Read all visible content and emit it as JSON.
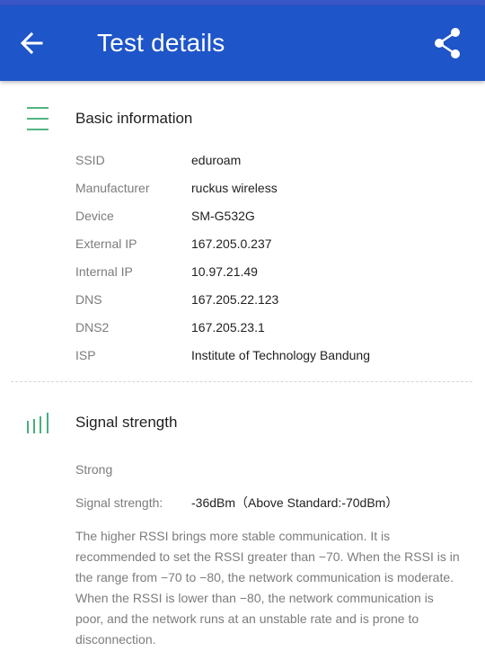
{
  "header": {
    "title": "Test details",
    "back_icon": "arrow-back-icon",
    "share_icon": "share-icon",
    "color": "#1e55c8"
  },
  "basic": {
    "title": "Basic information",
    "icon": "menu-lines-icon",
    "rows": [
      {
        "label": "SSID",
        "value": "eduroam"
      },
      {
        "label": "Manufacturer",
        "value": "ruckus wireless"
      },
      {
        "label": "Device",
        "value": "SM-G532G"
      },
      {
        "label": "External IP",
        "value": "167.205.0.237"
      },
      {
        "label": "Internal IP",
        "value": "10.97.21.49"
      },
      {
        "label": "DNS",
        "value": "167.205.22.123"
      },
      {
        "label": "DNS2",
        "value": "167.205.23.1"
      },
      {
        "label": "ISP",
        "value": "Institute of Technology Bandung"
      }
    ]
  },
  "signal": {
    "title": "Signal strength",
    "icon": "signal-bars-icon",
    "level": "Strong",
    "label": "Signal strength:",
    "value": "-36dBm（Above Standard:-70dBm）",
    "description": "The higher RSSI brings more stable communication. It is recommended to set the RSSI greater than −70. When the RSSI is in the range from −70 to −80, the network communication is moderate. When the RSSI is lower than −80, the network communication is poor, and the network runs at an unstable rate and is prone to disconnection."
  },
  "colors": {
    "accent_green": "#1a9b5a"
  }
}
